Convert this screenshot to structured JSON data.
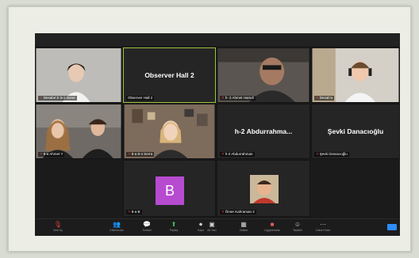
{
  "participants": [
    {
      "name": "",
      "label": "Desabe'Ji le ii Gene"
    },
    {
      "name": "Observer Hall  2",
      "label": "Observer Hall  2"
    },
    {
      "name": "",
      "label": "h- 2 Ahmet Hamdi"
    },
    {
      "name": "",
      "label": "Desab'a"
    },
    {
      "name": "",
      "label": "8-a Ahmet Y"
    },
    {
      "name": "",
      "label": "8-a 8-4 Serra"
    },
    {
      "name": "h-2  Abdurrahma...",
      "label": "h-2 Abdurrahman"
    },
    {
      "name": "Şevki Danacıoğlu",
      "label": "Şevki Danacıoğlu"
    },
    {
      "name": "",
      "label": "8-a B"
    },
    {
      "name": "",
      "label": "Ömer Kahraman 2"
    }
  ],
  "b_avatar_letter": "B",
  "toolbar": [
    {
      "label": "Sesi Aç",
      "icon": "mic-icon"
    },
    {
      "label": "Katılımcılar",
      "icon": "participants-icon"
    },
    {
      "label": "Sohbet",
      "icon": "chat-icon"
    },
    {
      "label": "Paylaş",
      "icon": "share-icon"
    },
    {
      "label": "Kayıt",
      "icon": "record-icon"
    },
    {
      "label": "Alt Yazı",
      "icon": "cc-icon"
    },
    {
      "label": "Odalar",
      "icon": "rooms-icon"
    },
    {
      "label": "Uygulamalar",
      "icon": "apps-icon"
    },
    {
      "label": "Tepkiler",
      "icon": "react-icon"
    },
    {
      "label": "Daha Fazla",
      "icon": "more-icon"
    }
  ],
  "colors": {
    "active_border": "#9cc43a",
    "avatar_b": "#b64bd0",
    "end_button": "#2d8cff"
  }
}
